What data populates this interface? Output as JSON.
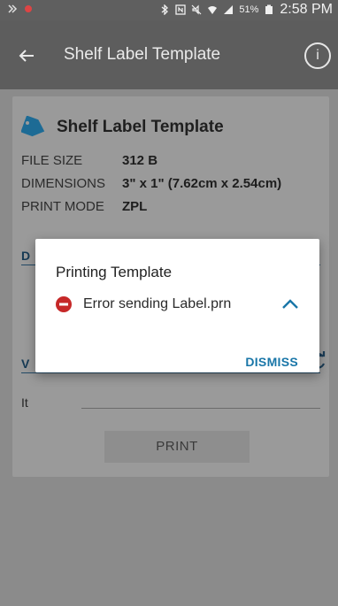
{
  "status_bar": {
    "battery_pct": "51%",
    "time": "2:58 PM"
  },
  "app_bar": {
    "title": "Shelf Label Template",
    "info_glyph": "i"
  },
  "file": {
    "title": "Shelf Label Template",
    "meta": [
      {
        "label": "FILE SIZE",
        "value": "312 B"
      },
      {
        "label": "DIMENSIONS",
        "value": "3\" x 1\" (7.62cm x 2.54cm)"
      },
      {
        "label": "PRINT MODE",
        "value": "ZPL"
      }
    ],
    "section1_letter": "D",
    "section2_letter": "V",
    "item_label": "It"
  },
  "print_button": "PRINT",
  "dialog": {
    "title": "Printing Template",
    "message": "Error sending Label.prn",
    "dismiss": "DISMISS"
  },
  "colors": {
    "accent": "#1976a8",
    "error": "#c62828",
    "tag": "#1d6b95"
  }
}
